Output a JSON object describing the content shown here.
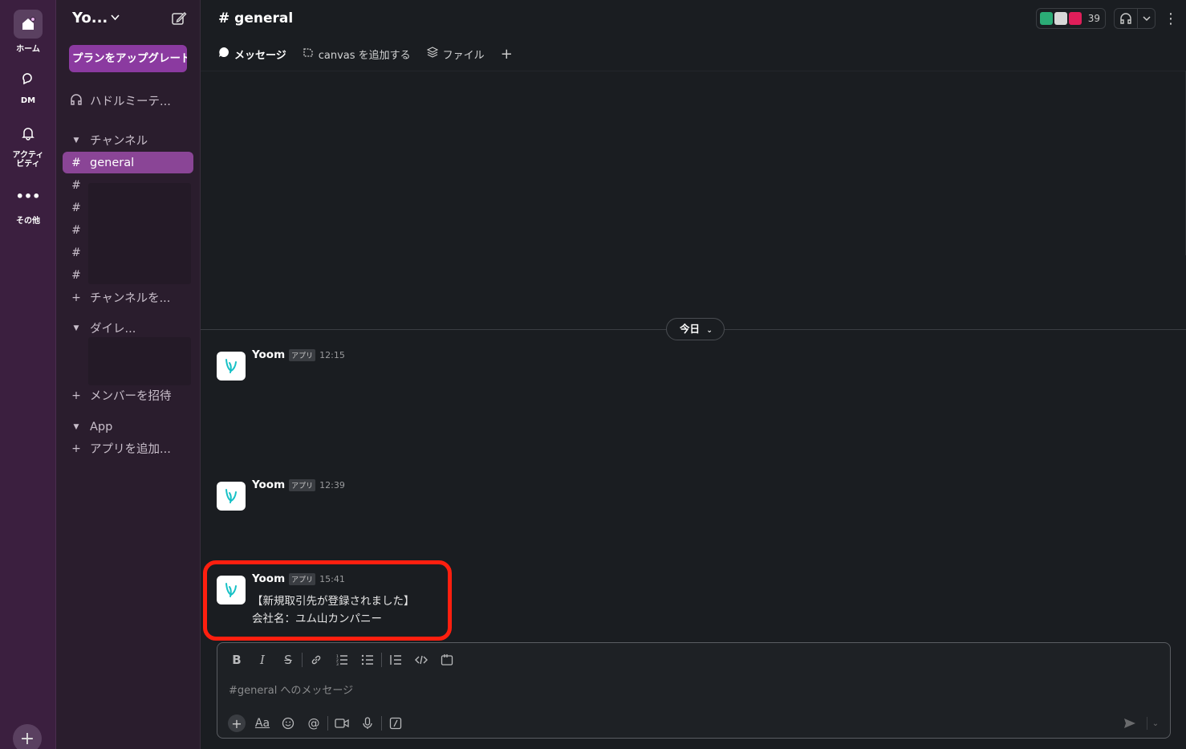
{
  "rail": {
    "items": [
      {
        "label": "ホーム",
        "icon": "home-icon"
      },
      {
        "label": "DM",
        "icon": "dm-icon"
      },
      {
        "label": "アクティ\nビティ",
        "icon": "bell-icon"
      },
      {
        "label": "その他",
        "icon": "more-icon"
      }
    ],
    "add_icon": "+"
  },
  "sidebar": {
    "workspace": "Yo...",
    "upgrade_label": "プランをアップグレード",
    "huddle_label": "ハドルミーテ...",
    "channels_header": "チャンネル",
    "channels": [
      {
        "hash": "#",
        "name": "general",
        "active": true
      },
      {
        "hash": "#",
        "name": ""
      },
      {
        "hash": "#",
        "name": ""
      },
      {
        "hash": "#",
        "name": ""
      },
      {
        "hash": "#",
        "name": ""
      },
      {
        "hash": "#",
        "name": ""
      }
    ],
    "add_channel_label": "チャンネルを...",
    "dm_header": "ダイレ...",
    "invite_label": "メンバーを招待",
    "app_header": "App",
    "add_app_label": "アプリを追加..."
  },
  "header": {
    "channel_title": "# general",
    "member_count": "39",
    "tabs": [
      {
        "label": "メッセージ",
        "icon": "message-icon"
      },
      {
        "label": "canvas を追加する",
        "icon": "canvas-icon"
      },
      {
        "label": "ファイル",
        "icon": "files-icon"
      }
    ]
  },
  "divider": {
    "label": "今日"
  },
  "messages": [
    {
      "author": "Yoom",
      "badge": "アプリ",
      "time": "12:15",
      "lines": []
    },
    {
      "author": "Yoom",
      "badge": "アプリ",
      "time": "12:39",
      "lines": []
    },
    {
      "author": "Yoom",
      "badge": "アプリ",
      "time": "15:41",
      "line1": "【新規取引先が登録されました】",
      "line2": "会社名：ユム山カンパニー"
    }
  ],
  "composer": {
    "placeholder": "#general へのメッセージ",
    "value": ""
  },
  "colors": {
    "rail_bg": "#3b1f3f",
    "sidebar_bg": "#2a1d2d",
    "active_channel": "#8a4596",
    "upgrade_btn": "#8b3aa0",
    "highlight": "#ff1f0f",
    "main_bg": "#1a1d21"
  }
}
